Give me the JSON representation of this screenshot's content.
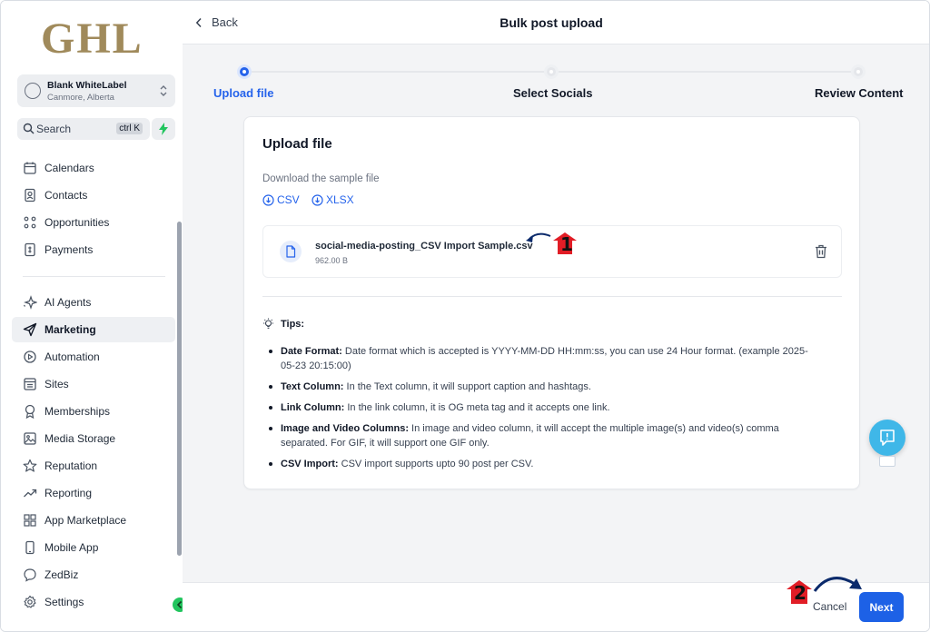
{
  "brand": {
    "logo_text": "GHL"
  },
  "account": {
    "name": "Blank WhiteLabel",
    "location": "Canmore, Alberta"
  },
  "search": {
    "label": "Search",
    "shortcut": "ctrl K"
  },
  "sidebar": {
    "group1": [
      {
        "label": "Calendars",
        "icon": "calendar-icon"
      },
      {
        "label": "Contacts",
        "icon": "contacts-icon"
      },
      {
        "label": "Opportunities",
        "icon": "opportunities-icon"
      },
      {
        "label": "Payments",
        "icon": "payments-icon"
      }
    ],
    "group2": [
      {
        "label": "AI Agents",
        "icon": "sparkle-icon"
      },
      {
        "label": "Marketing",
        "icon": "send-icon",
        "active": true
      },
      {
        "label": "Automation",
        "icon": "automation-icon"
      },
      {
        "label": "Sites",
        "icon": "sites-icon"
      },
      {
        "label": "Memberships",
        "icon": "memberships-icon"
      },
      {
        "label": "Media Storage",
        "icon": "image-icon"
      },
      {
        "label": "Reputation",
        "icon": "star-icon"
      },
      {
        "label": "Reporting",
        "icon": "trend-icon"
      },
      {
        "label": "App Marketplace",
        "icon": "grid-icon"
      },
      {
        "label": "Mobile App",
        "icon": "mobile-icon"
      },
      {
        "label": "ZedBiz",
        "icon": "chat-icon"
      },
      {
        "label": "Settings",
        "icon": "gear-icon"
      }
    ]
  },
  "header": {
    "back_label": "Back",
    "title": "Bulk post upload"
  },
  "steps": [
    {
      "label": "Upload file",
      "state": "active"
    },
    {
      "label": "Select Socials",
      "state": "pending"
    },
    {
      "label": "Review Content",
      "state": "pending"
    }
  ],
  "upload": {
    "title": "Upload file",
    "sample_label": "Download the sample file",
    "csv_label": "CSV",
    "xlsx_label": "XLSX",
    "file_name": "social-media-posting_CSV Import Sample.csv",
    "file_size": "962.00 B"
  },
  "tips": {
    "heading": "Tips:",
    "items": [
      {
        "title": "Date Format:",
        "text": " Date format which is accepted is YYYY-MM-DD HH:mm:ss, you can use 24 Hour format. (example 2025-05-23 20:15:00)"
      },
      {
        "title": "Text Column:",
        "text": " In the Text column, it will support caption and hashtags."
      },
      {
        "title": "Link Column:",
        "text": " In the link column, it is OG meta tag and it accepts one link."
      },
      {
        "title": "Image and Video Columns:",
        "text": " In image and video column, it will accept the multiple image(s) and video(s) comma separated. For GIF, it will support one GIF only."
      },
      {
        "title": "CSV Import:",
        "text": " CSV import supports upto 90 post per CSV."
      }
    ]
  },
  "footer": {
    "cancel_label": "Cancel",
    "next_label": "Next"
  },
  "annotations": {
    "one": "1",
    "two": "2"
  },
  "colors": {
    "primary": "#2563eb",
    "brand_gold": "#a08a5b",
    "success": "#22c55e",
    "feedback": "#3fb7e8"
  }
}
